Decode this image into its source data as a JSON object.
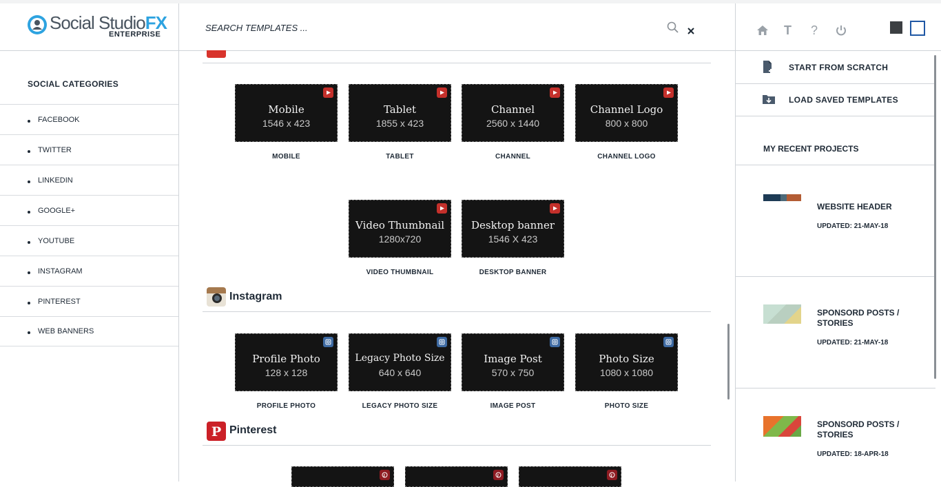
{
  "app": {
    "logo_main": "Social Studio",
    "logo_fx": "FX",
    "logo_sub": "ENTERPRISE"
  },
  "search": {
    "placeholder": "SEARCH TEMPLATES ..."
  },
  "categories": {
    "title": "SOCIAL CATEGORIES",
    "items": [
      "FACEBOOK",
      "TWITTER",
      "LINKEDIN",
      "GOOGLE+",
      "YOUTUBE",
      "INSTAGRAM",
      "PINTEREST",
      "WEB BANNERS"
    ]
  },
  "youtube": {
    "templates": [
      {
        "title": "Mobile",
        "size": "1546 x 423",
        "label": "MOBILE"
      },
      {
        "title": "Tablet",
        "size": "1855 x 423",
        "label": "TABLET"
      },
      {
        "title": "Channel",
        "size": "2560 x 1440",
        "label": "CHANNEL"
      },
      {
        "title": "Channel Logo",
        "size": "800 x 800",
        "label": "CHANNEL LOGO"
      },
      {
        "title": "Video Thumbnail",
        "size": "1280x720",
        "label": "VIDEO THUMBNAIL"
      },
      {
        "title": "Desktop banner",
        "size": "1546 X 423",
        "label": "DESKTOP BANNER"
      }
    ]
  },
  "instagram": {
    "title": "Instagram",
    "templates": [
      {
        "title": "Profile Photo",
        "size": "128 x 128",
        "label": "PROFILE PHOTO"
      },
      {
        "title": "Legacy Photo Size",
        "size": "640 x 640",
        "label": "LEGACY PHOTO SIZE"
      },
      {
        "title": "Image Post",
        "size": "570 x 750",
        "label": "IMAGE POST"
      },
      {
        "title": "Photo Size",
        "size": "1080 x 1080",
        "label": "PHOTO SIZE"
      }
    ]
  },
  "pinterest": {
    "title": "Pinterest"
  },
  "actions": {
    "start": "START FROM SCRATCH",
    "load": "LOAD SAVED TEMPLATES"
  },
  "toolbar": {
    "text_icon": "T",
    "help_icon": "?"
  },
  "recent": {
    "title": "MY RECENT PROJECTS",
    "projects": [
      {
        "title": "WEBSITE HEADER",
        "date": "UPDATED: 21-MAY-18"
      },
      {
        "title": "SPONSORD POSTS / STORIES",
        "date": "UPDATED: 21-MAY-18"
      },
      {
        "title": "SPONSORD POSTS / STORIES",
        "date": "UPDATED: 18-APR-18"
      }
    ]
  }
}
